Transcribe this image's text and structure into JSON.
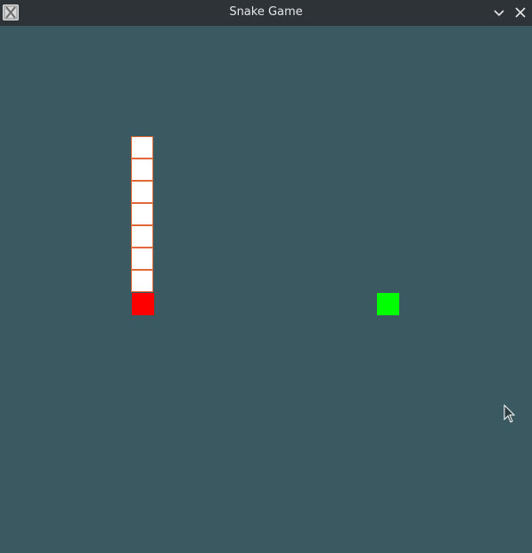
{
  "window": {
    "title": "Snake Game",
    "icon": "snake-app-icon",
    "buttons": [
      "minimize-icon",
      "close-icon"
    ]
  },
  "colors": {
    "background": "#3b5961",
    "snake_body": "#ffffff",
    "snake_body_border": "#e06a3a",
    "snake_head": "#ff0000",
    "food": "#00ff00"
  }
}
